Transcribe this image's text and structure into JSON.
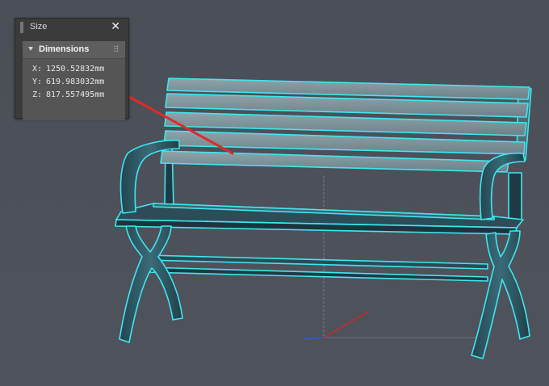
{
  "panel": {
    "title": "Size",
    "close_glyph": "✕",
    "section": {
      "title": "Dimensions",
      "rows": [
        {
          "axis": "X:",
          "value": "1250.52832mm"
        },
        {
          "axis": "Y:",
          "value": "619.983032mm"
        },
        {
          "axis": "Z:",
          "value": "817.557495mm"
        }
      ]
    }
  },
  "colors": {
    "selection_outline": "#3fe6f2",
    "bench_metal": "#2f5a66",
    "slat": "#7f949b",
    "annotation_arrow": "#e02a2a",
    "gizmo_x": "#d02828",
    "gizmo_z": "#2a5fd0"
  },
  "icons": [
    "grip-icon",
    "close-icon",
    "collapse-triangle-icon"
  ]
}
